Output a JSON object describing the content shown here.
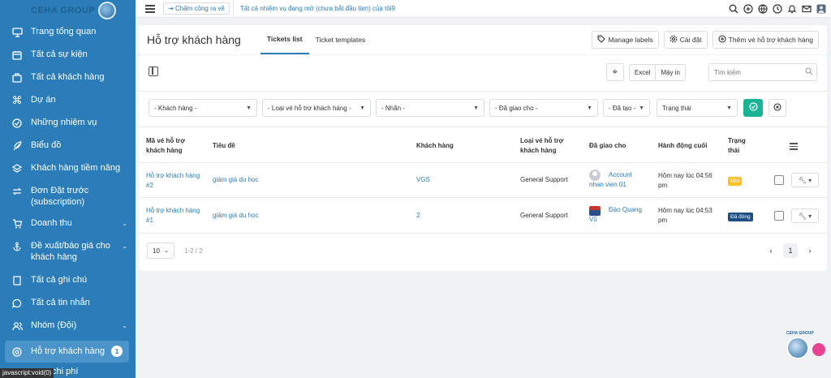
{
  "sidebar": {
    "logo_text": "CEHA GROUP",
    "items": [
      {
        "label": "Trang tổng quan",
        "icon": "monitor-icon",
        "chevron": ""
      },
      {
        "label": "Tất cả sự kiện",
        "icon": "calendar-icon",
        "chevron": ""
      },
      {
        "label": "Tất cả khách hàng",
        "icon": "briefcase-icon",
        "chevron": ""
      },
      {
        "label": "Dự án",
        "icon": "command-icon",
        "chevron": ""
      },
      {
        "label": "Những nhiệm vụ",
        "icon": "check-circle-icon",
        "chevron": ""
      },
      {
        "label": "Biểu đồ",
        "icon": "feather-icon",
        "chevron": ""
      },
      {
        "label": "Khách hàng tiềm năng",
        "icon": "layers-icon",
        "chevron": ""
      },
      {
        "label": "Đơn Đặt trước (subscription)",
        "icon": "repeat-icon",
        "chevron": ""
      },
      {
        "label": "Doanh thu",
        "icon": "cart-icon",
        "chevron": "⌄"
      },
      {
        "label": "Đề xuất/báo giá cho khách hàng",
        "icon": "anchor-icon",
        "chevron": "⌄"
      },
      {
        "label": "Tất cả ghi chú",
        "icon": "book-icon",
        "chevron": ""
      },
      {
        "label": "Tất cả tin nhắn",
        "icon": "message-icon",
        "chevron": ""
      },
      {
        "label": "Nhóm (Đội)",
        "icon": "users-icon",
        "chevron": "⌄"
      },
      {
        "label": "Hỗ trợ khách hàng",
        "icon": "lifebuoy-icon",
        "badge": "1"
      }
    ],
    "partial_item": "chi phí",
    "status_tip": "javascript:void(0)"
  },
  "topbar": {
    "clock_in": "Chấm công ra về",
    "task_link": "Tất cả nhiệm vụ đang mở (chưa bắt đầu làm) của tôi9",
    "icons": [
      "search-icon",
      "plus-circle-icon",
      "globe-icon",
      "clock-icon",
      "bell-icon",
      "mail-icon",
      "user-avatar-icon"
    ]
  },
  "header": {
    "title": "Hỗ trợ khách hàng",
    "tabs": [
      "Tickets list",
      "Ticket templates"
    ],
    "manage_labels": "Manage labels",
    "settings": "Cài đặt",
    "add_ticket": "Thêm vé hỗ trợ khách hàng"
  },
  "toolbar": {
    "excel": "Excel",
    "print": "Máy in",
    "search_placeholder": "Tìm kiếm"
  },
  "filters": {
    "client": "- Khách hàng -",
    "ticket_type": "- Loại vé hỗ trợ khách hàng -",
    "label": "- Nhãn -",
    "assigned": "- Đã giao cho -",
    "created": "- Đã tạo -",
    "status": "Trạng thái"
  },
  "table": {
    "headers": {
      "id": "Mã vé hỗ trợ khách hàng",
      "title": "Tiêu đề",
      "client": "Khách hàng",
      "type": "Loại vé hỗ trợ khách hàng",
      "assigned": "Đã giao cho",
      "last_activity": "Hành động cuối",
      "status": "Trạng thái"
    },
    "rows": [
      {
        "id": "Hỗ trợ khách hàng #2",
        "title": "giảm giá du học",
        "client": "VGS",
        "type": "General Support",
        "assigned": "Account nhan vien 01",
        "last_activity": "Hôm nay lúc 04:56 pm",
        "status": "Mới",
        "status_color": "#f7c325"
      },
      {
        "id": "Hỗ trợ khách hàng #1",
        "title": "giảm giá du học",
        "client": "2",
        "type": "General Support",
        "assigned": "Đào Quang Vũ",
        "last_activity": "Hôm nay lúc 04:53 pm",
        "status": "Đã đóng",
        "status_color": "#1d4f85"
      }
    ]
  },
  "pagination": {
    "page_size": "10",
    "info": "1-2 / 2",
    "current": "1"
  },
  "chat_widget": {
    "text": "CEHA GROUP"
  }
}
